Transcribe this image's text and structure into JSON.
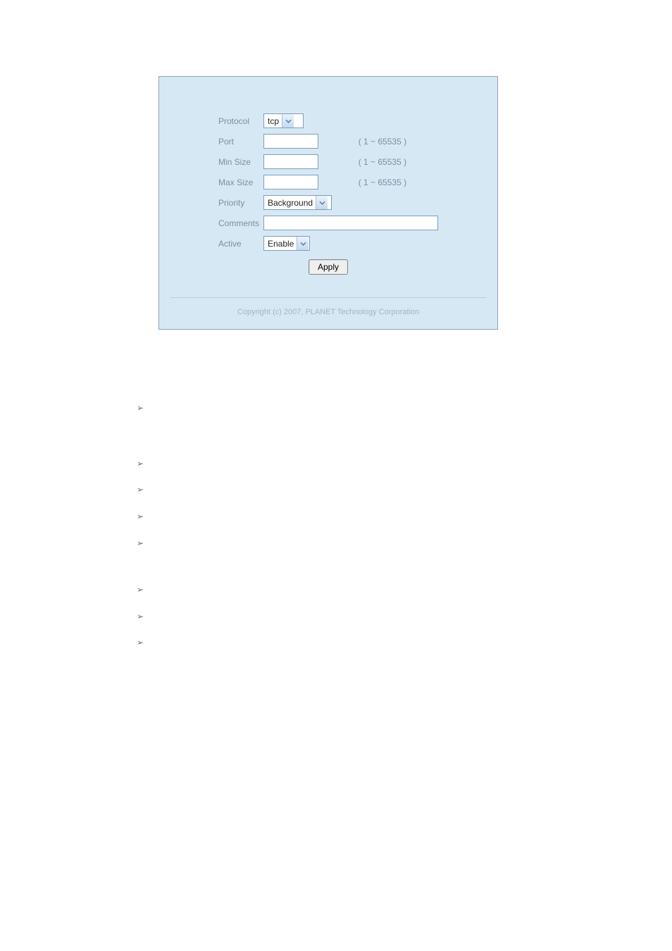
{
  "form": {
    "protocol": {
      "label": "Protocol",
      "selected": "tcp"
    },
    "port": {
      "label": "Port",
      "value": "",
      "hint": "( 1 ~ 65535 )"
    },
    "min_size": {
      "label": "Min Size",
      "value": "",
      "hint": "( 1 ~ 65535 )"
    },
    "max_size": {
      "label": "Max Size",
      "value": "",
      "hint": "( 1 ~ 65535 )"
    },
    "priority": {
      "label": "Priority",
      "selected": "Background"
    },
    "comments": {
      "label": "Comments",
      "value": ""
    },
    "active": {
      "label": "Active",
      "selected": "Enable"
    },
    "apply_label": "Apply"
  },
  "footer": {
    "copyright": "Copyright (c) 2007, PLANET Technology Corporation"
  },
  "bullets": [
    "➢",
    "➢",
    "➢",
    "➢",
    "➢",
    "➢",
    "➢",
    "➢"
  ]
}
